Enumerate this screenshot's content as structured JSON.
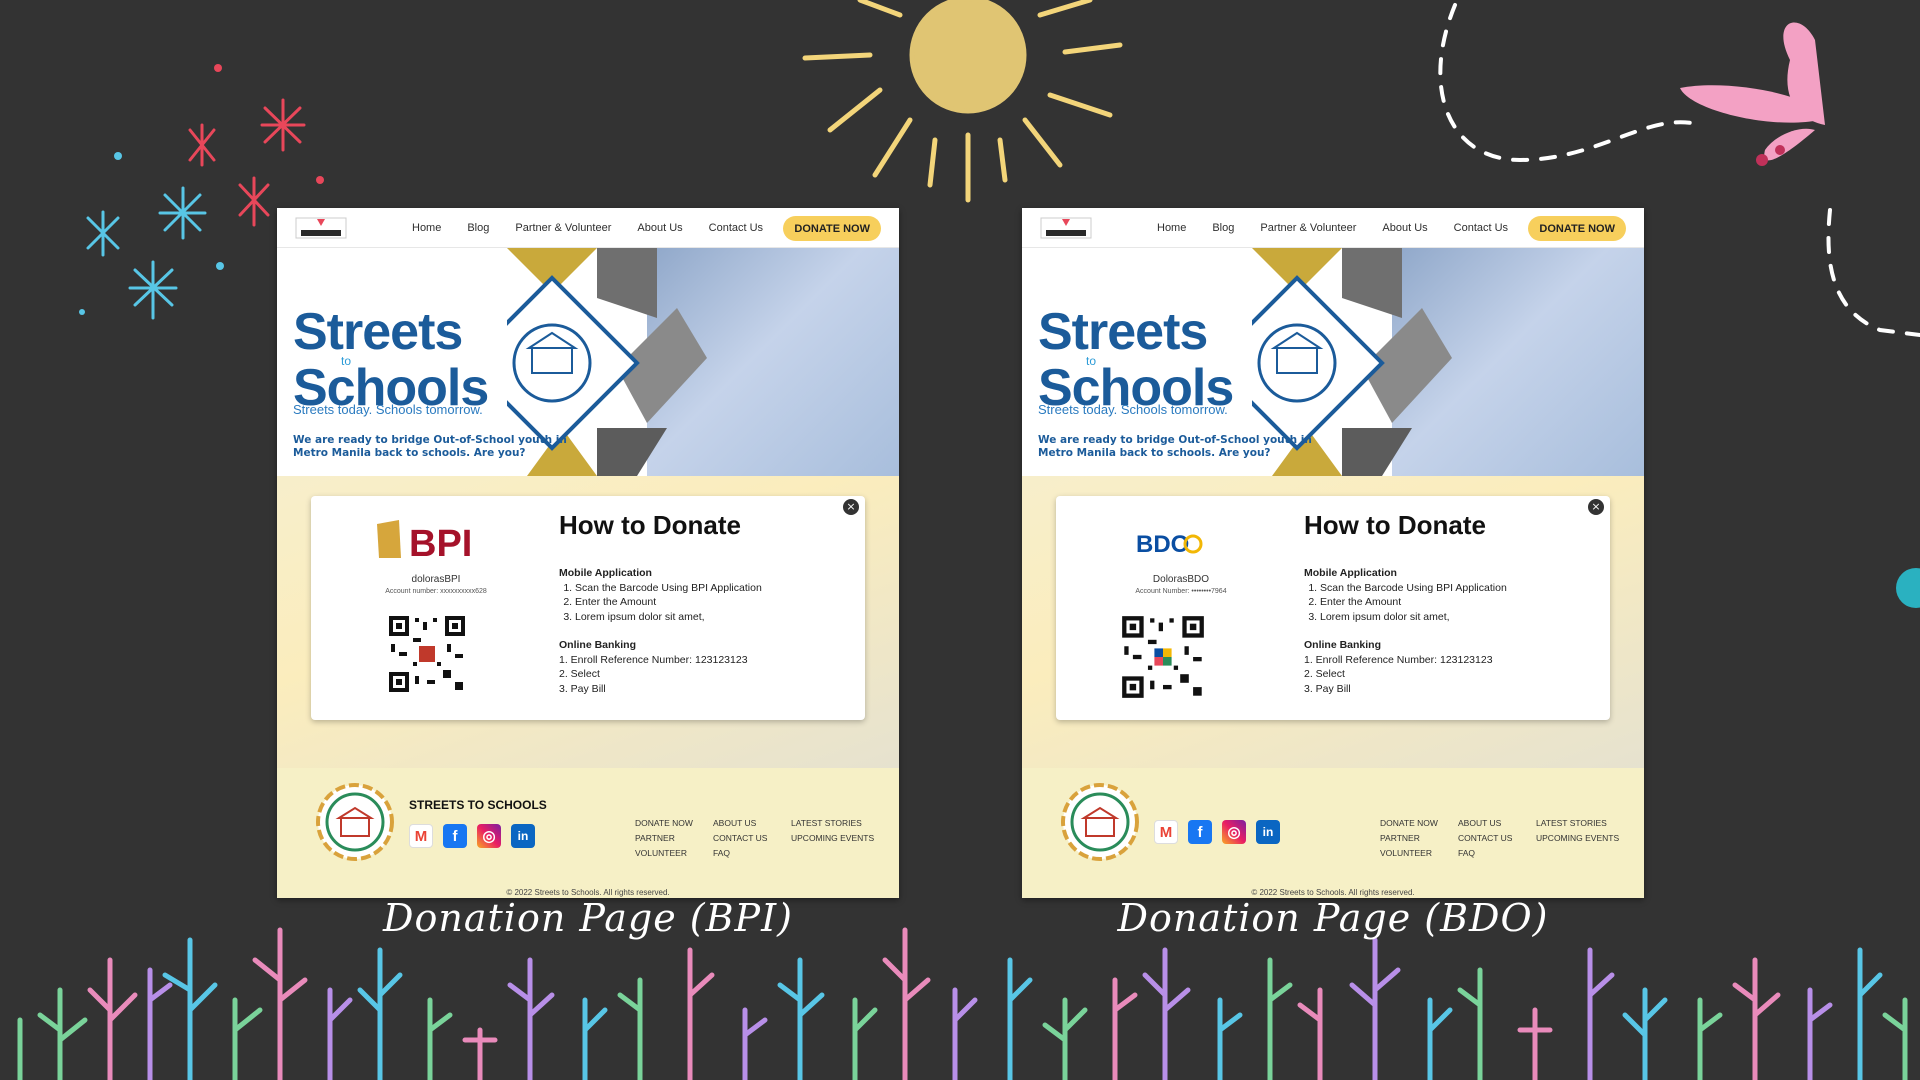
{
  "colors": {
    "background": "#333333",
    "brand_blue": "#1b5b9a",
    "donate_button": "#f7cf5c",
    "bpi_red": "#a5122a",
    "bdo_blue": "#0a4ea2",
    "bdo_gold": "#f2b705",
    "footer_bg": "#f6f0c6"
  },
  "pages": [
    {
      "nav": {
        "links": [
          "Home",
          "Blog",
          "Partner & Volunteer",
          "About Us",
          "Contact Us"
        ],
        "donate_label": "DONATE NOW"
      },
      "hero": {
        "title_line1": "Streets",
        "title_to": "to",
        "title_line2": "Schools",
        "tagline": "Streets today. Schools tomorrow.",
        "subtext": "We are ready to bridge Out-of-School youth in Metro Manila back to schools. Are you?"
      },
      "modal": {
        "bank_logo_icon": "bpi-logo",
        "bank_text": "BPI",
        "account_name": "dolorasBPI",
        "account_number": "Account number: xxxxxxxxxx628",
        "title": "How to Donate",
        "mobile_heading": "Mobile Application",
        "mobile_steps": [
          "Scan the Barcode Using BPI Application",
          "Enter the Amount",
          "Lorem ipsum dolor sit amet,"
        ],
        "online_heading": "Online Banking",
        "online_steps": [
          "1. Enroll Reference Number: 123123123",
          "2. Select",
          "3. Pay Bill"
        ],
        "close_icon": "close-icon"
      },
      "footer": {
        "name": "STREETS TO SCHOOLS",
        "col1": [
          "DONATE NOW",
          "PARTNER",
          "VOLUNTEER"
        ],
        "col2": [
          "ABOUT US",
          "CONTACT US",
          "FAQ"
        ],
        "col3": [
          "LATEST STORIES",
          "UPCOMING EVENTS"
        ],
        "copyright": "© 2022 Streets to Schools. All rights reserved."
      },
      "caption": "Donation Page (BPI)"
    },
    {
      "nav": {
        "links": [
          "Home",
          "Blog",
          "Partner & Volunteer",
          "About Us",
          "Contact Us"
        ],
        "donate_label": "DONATE NOW"
      },
      "hero": {
        "title_line1": "Streets",
        "title_to": "to",
        "title_line2": "Schools",
        "tagline": "Streets today. Schools tomorrow.",
        "subtext": "We are ready to bridge Out-of-School youth in Metro Manila back to schools. Are you?"
      },
      "modal": {
        "bank_logo_icon": "bdo-logo",
        "bank_text": "BDO",
        "account_name": "DolorasBDO",
        "account_number": "Account Number: ••••••••7964",
        "title": "How to Donate",
        "mobile_heading": "Mobile Application",
        "mobile_steps": [
          "Scan the Barcode Using BPI Application",
          "Enter the Amount",
          "Lorem ipsum dolor sit amet,"
        ],
        "online_heading": "Online Banking",
        "online_steps": [
          "1. Enroll Reference Number: 123123123",
          "2. Select",
          "3. Pay Bill"
        ],
        "close_icon": "close-icon"
      },
      "footer": {
        "name": "",
        "col1": [
          "DONATE NOW",
          "PARTNER",
          "VOLUNTEER"
        ],
        "col2": [
          "ABOUT US",
          "CONTACT US",
          "FAQ"
        ],
        "col3": [
          "LATEST STORIES",
          "UPCOMING EVENTS"
        ],
        "copyright": "© 2022 Streets to Schools. All rights reserved."
      },
      "caption": "Donation Page (BDO)"
    }
  ]
}
